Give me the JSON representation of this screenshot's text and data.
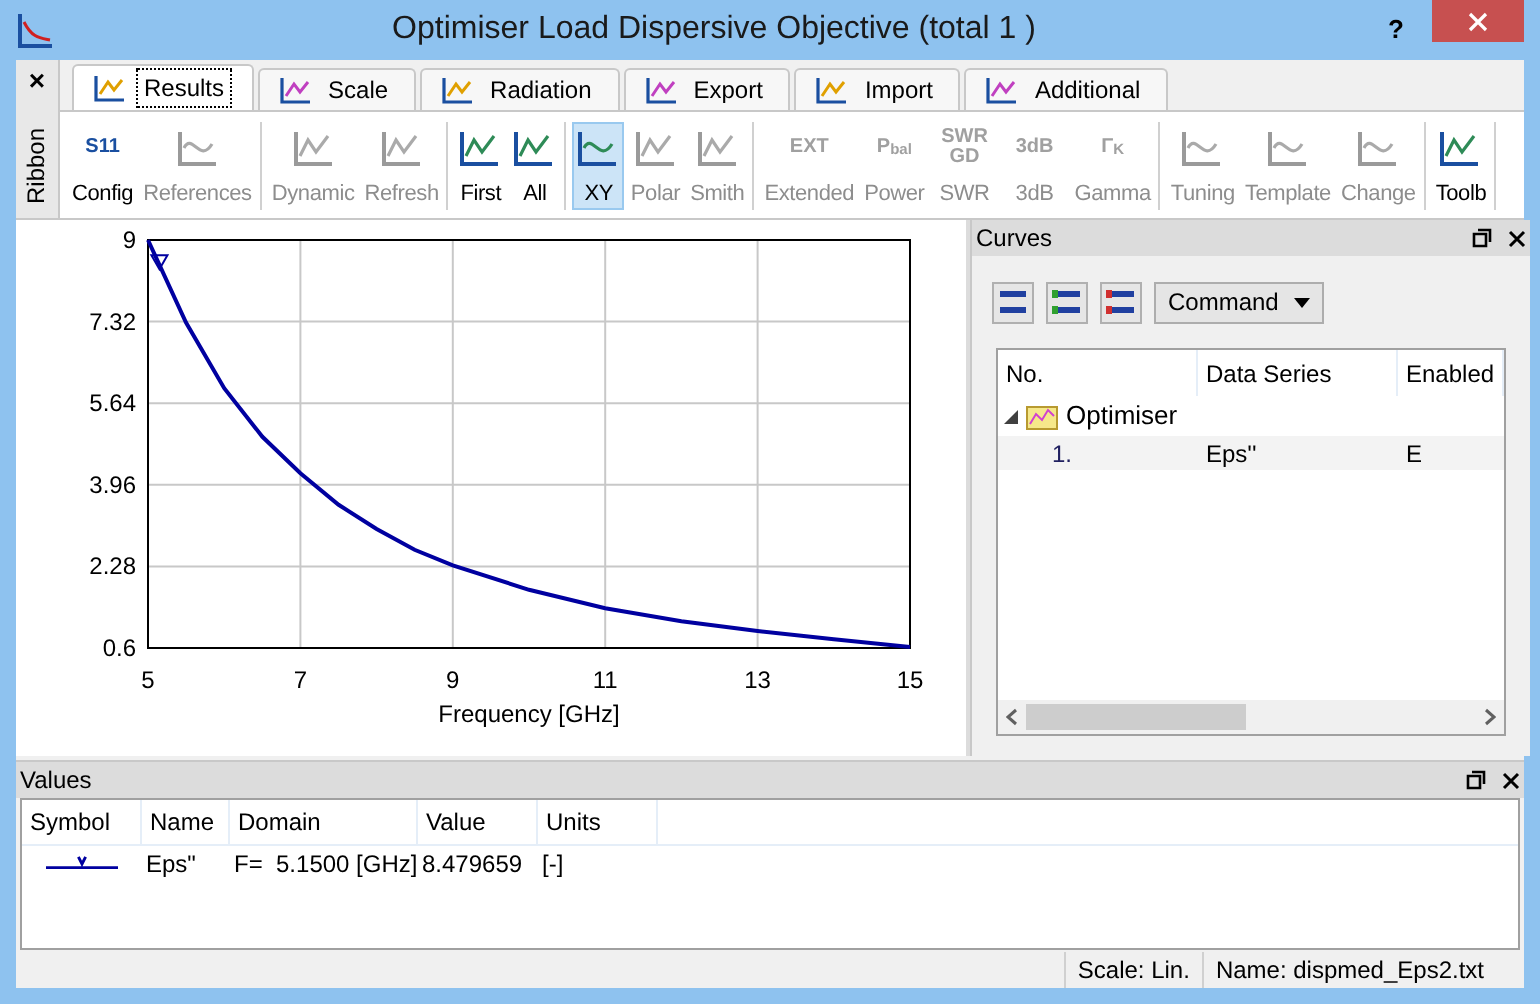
{
  "window": {
    "title": "Optimiser Load Dispersive Objective (total 1 )",
    "help": "?"
  },
  "ribbon": {
    "close": "×",
    "label": "Ribbon",
    "tabs": [
      {
        "label": "Results",
        "selected": true
      },
      {
        "label": "Scale",
        "selected": false
      },
      {
        "label": "Radiation",
        "selected": false
      },
      {
        "label": "Export",
        "selected": false
      },
      {
        "label": "Import",
        "selected": false
      },
      {
        "label": "Additional",
        "selected": false
      }
    ],
    "groups": [
      [
        {
          "label": "Config",
          "disabled": false,
          "selected": false,
          "icon_text": "S11"
        },
        {
          "label": "References",
          "disabled": true,
          "selected": false
        }
      ],
      [
        {
          "label": "Dynamic",
          "disabled": true,
          "selected": false
        },
        {
          "label": "Refresh",
          "disabled": true,
          "selected": false
        }
      ],
      [
        {
          "label": "First",
          "disabled": false,
          "selected": false
        },
        {
          "label": "All",
          "disabled": false,
          "selected": false
        }
      ],
      [
        {
          "label": "XY",
          "disabled": false,
          "selected": true
        },
        {
          "label": "Polar",
          "disabled": true,
          "selected": false
        },
        {
          "label": "Smith",
          "disabled": true,
          "selected": false
        }
      ],
      [
        {
          "label": "Extended",
          "disabled": true,
          "selected": false,
          "icon_text": "EXT"
        },
        {
          "label": "Power",
          "disabled": true,
          "selected": false,
          "icon_text": "P$_{bal}$"
        },
        {
          "label": "SWR",
          "disabled": true,
          "selected": false,
          "icon_text": "SWR GD"
        },
        {
          "label": "3dB",
          "disabled": true,
          "selected": false,
          "icon_text": "3dB"
        },
        {
          "label": "Gamma",
          "disabled": true,
          "selected": false,
          "icon_text": "Γ$_{K}$"
        }
      ],
      [
        {
          "label": "Tuning",
          "disabled": true,
          "selected": false
        },
        {
          "label": "Template",
          "disabled": true,
          "selected": false
        },
        {
          "label": "Change",
          "disabled": true,
          "selected": false
        }
      ],
      [
        {
          "label": "Toolb",
          "disabled": false,
          "selected": false
        }
      ]
    ]
  },
  "plot": {
    "chart_data": {
      "type": "line",
      "xlabel": "Frequency [GHz]",
      "x": [
        5,
        5.5,
        6,
        6.5,
        7,
        7.5,
        8,
        8.5,
        9,
        10,
        11,
        12,
        13,
        14,
        15
      ],
      "grid": true,
      "series": [
        {
          "color": "#0000a0",
          "values": [
            9.0,
            7.3,
            5.95,
            4.95,
            4.2,
            3.55,
            3.05,
            2.62,
            2.3,
            1.8,
            1.42,
            1.15,
            0.95,
            0.78,
            0.62
          ]
        }
      ],
      "xlim": [
        5,
        15
      ],
      "ylim": [
        0.6,
        9
      ],
      "xticks": [
        5,
        7,
        9,
        11,
        13,
        15
      ],
      "yticks": [
        0.6,
        2.28,
        3.96,
        5.64,
        7.32,
        9
      ]
    }
  },
  "curves": {
    "title": "Curves",
    "command": "Command",
    "columns": [
      "No.",
      "Data Series",
      "Enabled"
    ],
    "groups": [
      {
        "name": "Optimiser",
        "expanded": true,
        "children": [
          {
            "no": "1.",
            "series": "Eps''",
            "enabled": "E"
          }
        ]
      }
    ]
  },
  "values": {
    "title": "Values",
    "columns": [
      "Symbol",
      "Name",
      "Domain",
      "Value",
      "Units"
    ],
    "rows": [
      {
        "name": "Eps\"",
        "domain": "F=  5.1500 [GHz]",
        "value": "8.479659",
        "units": "[-]",
        "color": "#0000a0"
      }
    ]
  },
  "status_bar": [
    "Scale: Lin.",
    "Name: dispmed_Eps2.txt"
  ]
}
